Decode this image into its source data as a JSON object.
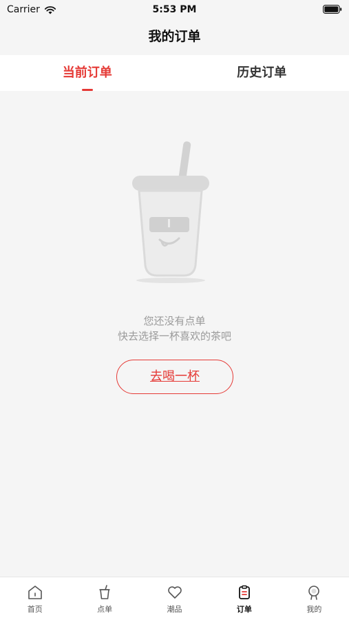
{
  "status_bar": {
    "carrier": "Carrier",
    "time": "5:53 PM"
  },
  "nav": {
    "title": "我的订单"
  },
  "tabs": [
    {
      "label": "当前订单",
      "active": true
    },
    {
      "label": "历史订单",
      "active": false
    }
  ],
  "empty_state": {
    "line1": "您还没有点单",
    "line2": "快去选择一杯喜欢的茶吧",
    "button_label": "去喝一杯"
  },
  "tab_bar": {
    "items": [
      {
        "label": "首页",
        "icon": "home-icon",
        "active": false
      },
      {
        "label": "点单",
        "icon": "cup-icon",
        "active": false
      },
      {
        "label": "潮品",
        "icon": "heart-icon",
        "active": false
      },
      {
        "label": "订单",
        "icon": "order-icon",
        "active": true
      },
      {
        "label": "我的",
        "icon": "profile-icon",
        "active": false
      }
    ]
  },
  "colors": {
    "accent": "#e53935",
    "background": "#f5f5f5",
    "muted_text": "#9a9a9a"
  }
}
